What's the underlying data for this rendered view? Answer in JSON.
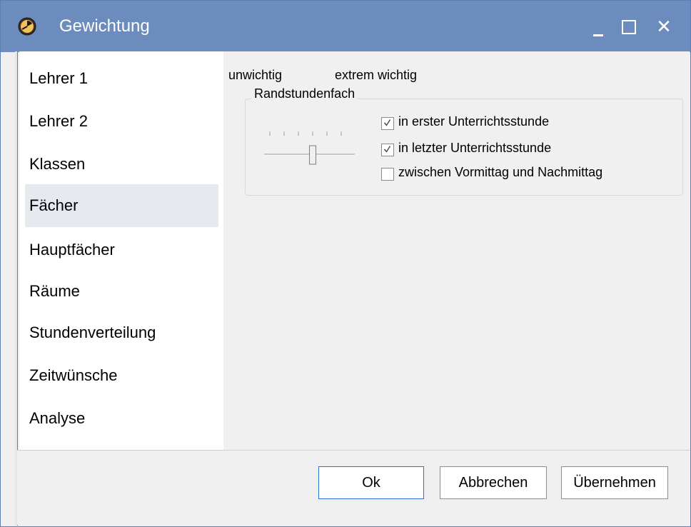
{
  "window": {
    "title": "Gewichtung",
    "icon": "clock-icon"
  },
  "sidebar": {
    "items": [
      {
        "label": "Lehrer 1"
      },
      {
        "label": "Lehrer 2"
      },
      {
        "label": "Klassen"
      },
      {
        "label": "Fächer",
        "selected": true
      },
      {
        "label": "Hauptfächer"
      },
      {
        "label": "Räume"
      },
      {
        "label": "Stundenverteilung"
      },
      {
        "label": "Zeitwünsche"
      },
      {
        "label": "Analyse"
      }
    ]
  },
  "content": {
    "scale_low_label": "unwichtig",
    "scale_high_label": "extrem wichtig",
    "group": {
      "title": "Randstundenfach",
      "slider_level": 0.5,
      "checkboxes": [
        {
          "label": "in erster Unterrichtsstunde",
          "checked": true
        },
        {
          "label": "in letzter Unterrichtsstunde",
          "checked": true
        },
        {
          "label": "zwischen Vormittag und Nachmittag",
          "checked": false
        }
      ]
    }
  },
  "footer": {
    "ok_label": "Ok",
    "cancel_label": "Abbrechen",
    "apply_label": "Übernehmen"
  },
  "colors": {
    "titlebar": "#6b8cbc",
    "selected_item": "#e6e9ef",
    "default_button_border": "#2d6fd1"
  }
}
